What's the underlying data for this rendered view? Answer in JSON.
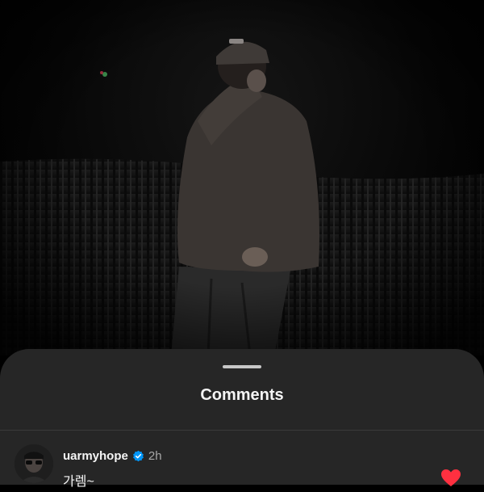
{
  "photo": {
    "description_icon": "photo-of-person-on-stage"
  },
  "sheet": {
    "title": "Comments"
  },
  "comment": {
    "username": "uarmyhope",
    "verified_icon": "verified-badge-icon",
    "time": "2h",
    "text": "가렘~",
    "like_icon": "heart-icon",
    "like_color": "#ff3040"
  },
  "colors": {
    "sheet_bg": "#262626",
    "accent_verified": "#0095f6"
  }
}
